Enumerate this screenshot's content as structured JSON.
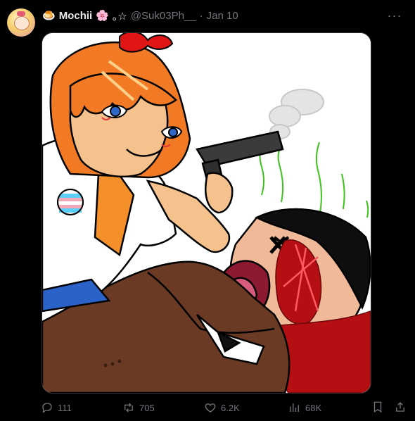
{
  "post": {
    "avatar_icon": "anime-avatar",
    "prefix_emoji": "🍮",
    "name": "Mochii",
    "name_emoji": "🌸",
    "name_suffix": "｡☆",
    "handle": "@Suk03Ph__",
    "separator": "·",
    "date": "Jan 10",
    "more_icon": "more-dots-icon"
  },
  "media": {
    "icon": "anime-illustration-image"
  },
  "actions": {
    "replies": "111",
    "reposts": "705",
    "likes": "6.2K",
    "views": "68K",
    "reply_icon": "reply-icon",
    "repost_icon": "repost-icon",
    "like_icon": "heart-icon",
    "views_icon": "views-chart-icon",
    "bookmark_icon": "bookmark-icon",
    "share_icon": "share-icon"
  }
}
